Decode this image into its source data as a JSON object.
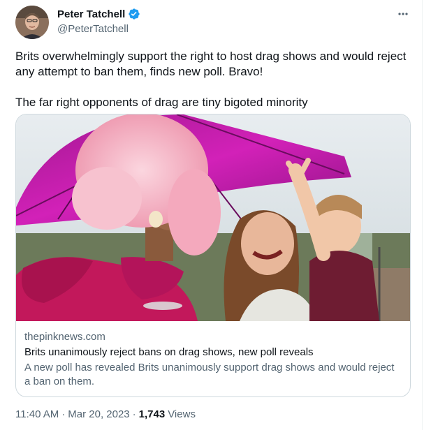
{
  "author": {
    "display_name": "Peter Tatchell",
    "handle": "@PeterTatchell",
    "verified": true
  },
  "tweet": {
    "paragraph_1": "Brits overwhelmingly support the right to host drag shows and would reject any attempt to ban them, finds new poll. Bravo!",
    "paragraph_2": "The far right opponents of drag are tiny bigoted minority"
  },
  "link_card": {
    "domain": "thepinknews.com",
    "title": "Brits unanimously reject bans on drag shows, new poll reveals",
    "description": "A new poll has revealed Brits unanimously support drag shows and would reject a ban on them."
  },
  "meta": {
    "time": "11:40 AM",
    "separator_1": "·",
    "date": "Mar 20, 2023",
    "separator_2": "·",
    "views_count": "1,743",
    "views_label": "Views"
  },
  "colors": {
    "verified_blue": "#1d9bf0",
    "umbrella_magenta": "#c21aa8",
    "dress_pink": "#c2185b",
    "wig_pink": "#f5b8c8"
  },
  "icons": {
    "verified": "verified-badge-icon",
    "more": "more-horizontal-icon"
  }
}
